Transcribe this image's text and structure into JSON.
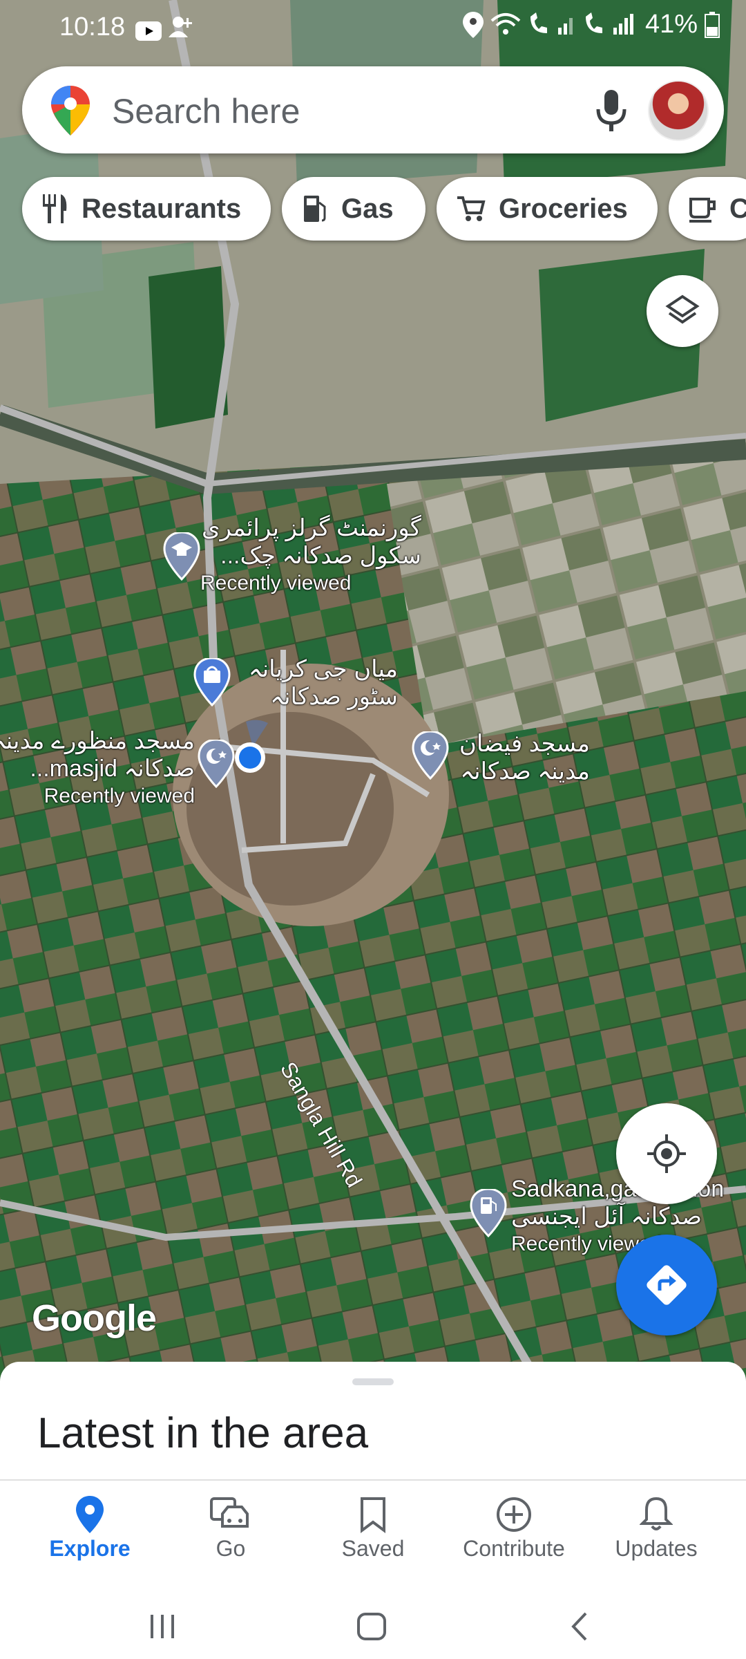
{
  "status_bar": {
    "time": "10:18",
    "battery": "41%"
  },
  "search": {
    "placeholder": "Search here"
  },
  "chips": [
    {
      "label": "Restaurants",
      "icon": "restaurant-icon"
    },
    {
      "label": "Gas",
      "icon": "gas-station-icon"
    },
    {
      "label": "Groceries",
      "icon": "cart-icon"
    },
    {
      "label": "C",
      "icon": "coffee-icon"
    }
  ],
  "map": {
    "watermark": "Google",
    "road": "Sangla Hill Rd",
    "places": [
      {
        "line1": "گورنمنٹ گرلز پرائمری",
        "line2": "سکول صدکانہ چک...",
        "line3": "Recently viewed",
        "icon": "school-icon"
      },
      {
        "line1": "میاں جی کریانہ",
        "line2": "سٹور صدکانہ",
        "icon": "shopping-bag-icon"
      },
      {
        "line1": "مسجد منظورے مدینہ",
        "line2": "صدکانہ masjid...",
        "line3": "Recently viewed",
        "icon": "mosque-icon"
      },
      {
        "line1": "مسجد فیضان",
        "line2": "مدینہ صدکانہ",
        "icon": "mosque-icon"
      },
      {
        "line1": "Sadkana,gas station",
        "line2": "صدکانہ آئل ایجنسی",
        "line3": "Recently viewed",
        "icon": "gas-station-icon"
      }
    ]
  },
  "sheet": {
    "title": "Latest in the area"
  },
  "nav": [
    {
      "label": "Explore",
      "icon": "explore-pin-icon",
      "active": true
    },
    {
      "label": "Go",
      "icon": "car-icon"
    },
    {
      "label": "Saved",
      "icon": "bookmark-icon"
    },
    {
      "label": "Contribute",
      "icon": "add-circle-icon"
    },
    {
      "label": "Updates",
      "icon": "bell-icon"
    }
  ],
  "colors": {
    "accent": "#1a73e8",
    "pin": "#7e8fb3"
  }
}
